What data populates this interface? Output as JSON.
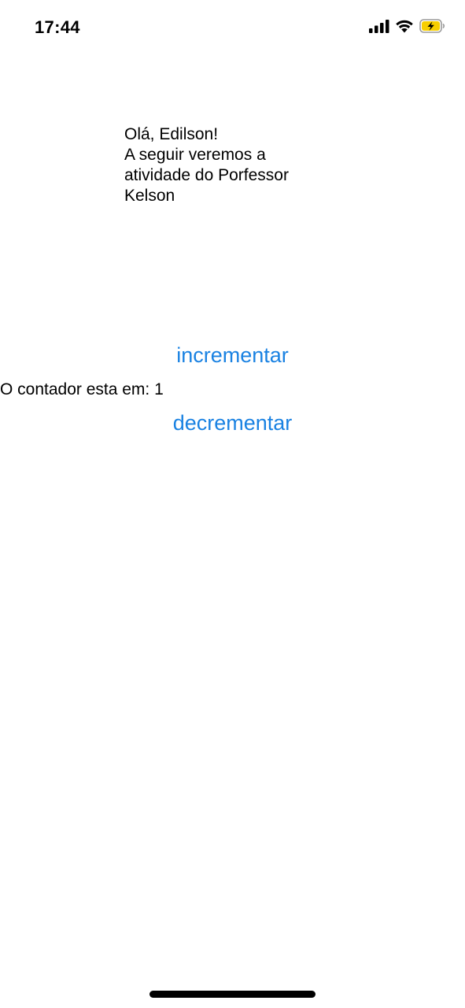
{
  "status_bar": {
    "time": "17:44",
    "icons": [
      "cellular-signal-icon",
      "wifi-icon",
      "battery-charging-icon"
    ],
    "battery_fill_color": "#f7ce00"
  },
  "greeting": {
    "text": "Olá, Edilson!\nA seguir  veremos a\natividade do Porfessor\nKelson"
  },
  "counter": {
    "increment_label": "incrementar",
    "label": "O contador esta em: ",
    "value": "1",
    "decrement_label": "decrementar"
  },
  "colors": {
    "button_text": "#1a82e2",
    "text": "#000000",
    "background": "#ffffff"
  }
}
